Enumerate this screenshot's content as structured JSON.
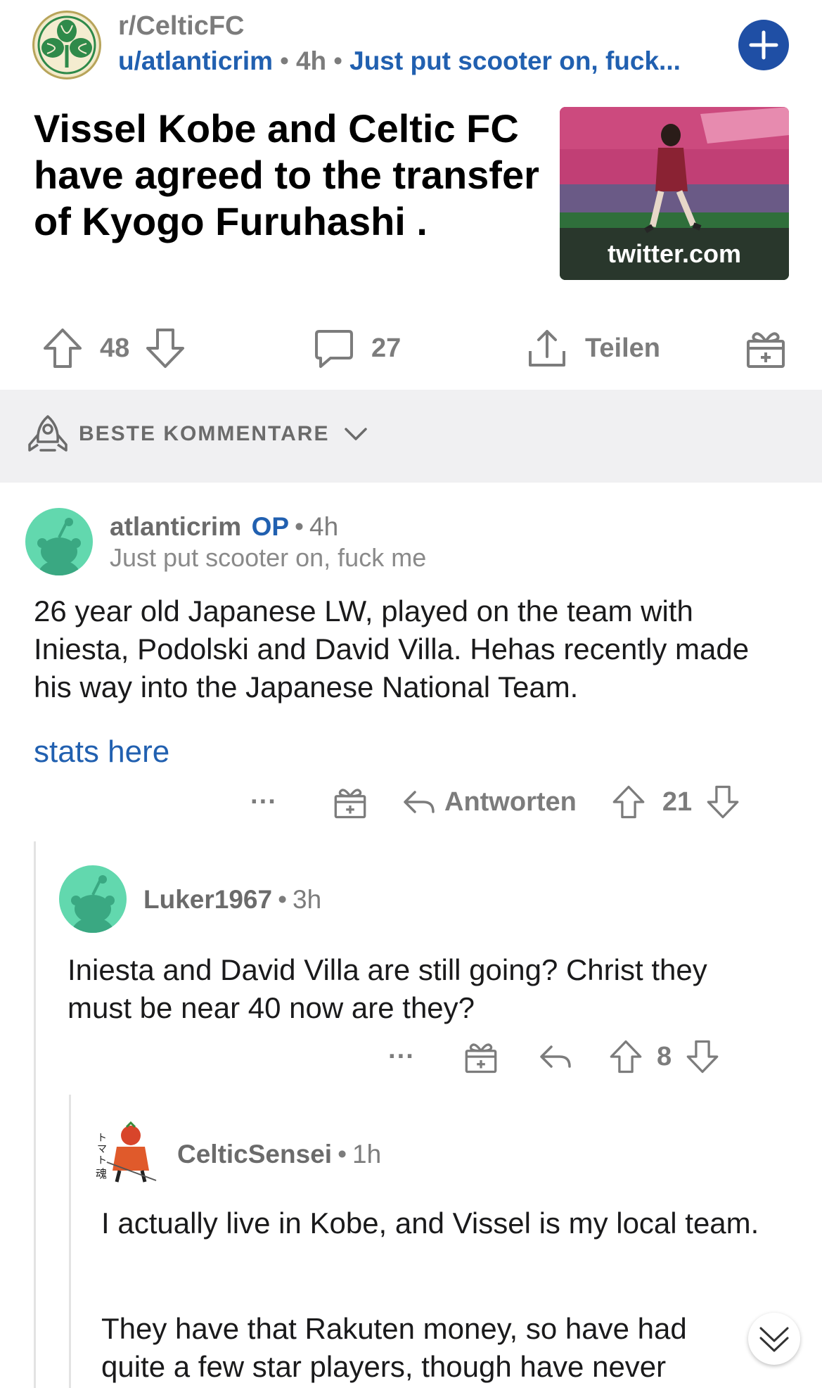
{
  "post": {
    "subreddit": "r/CelticFC",
    "author": "u/atlanticrim",
    "age": "4h",
    "flair": "Just put scooter on, fuck...",
    "title": "Vissel Kobe and Celtic FC have agreed to the transfer of Kyogo Furuhashi .",
    "thumbnail_domain": "twitter.com",
    "upvotes": "48",
    "comments": "27",
    "share_label": "Teilen"
  },
  "sort": {
    "label": "BESTE KOMMENTARE"
  },
  "comments": [
    {
      "author": "atlanticrim",
      "op_badge": "OP",
      "age": "4h",
      "flair": "Just put scooter on, fuck me",
      "body": "26 year old Japanese LW, played on the team with Iniesta, Podolski and David Villa. Hehas recently made his way into the Japanese National Team.",
      "link_text": "stats here",
      "more": "···",
      "reply_label": "Antworten",
      "score": "21"
    },
    {
      "author": "Luker1967",
      "age": "3h",
      "body": "Iniesta and David Villa are still going? Christ they must be near 40 now are they?",
      "more": "···",
      "score": "8"
    },
    {
      "author": "CelticSensei",
      "age": "1h",
      "body_p1": "I actually live in Kobe, and Vissel is my local team.",
      "body_p2": "They have that Rakuten money, so have had quite a few star players, though have never"
    }
  ],
  "colors": {
    "accent": "#2160b0",
    "join_button": "#1f4fa5",
    "avatar_green": "#62d8ae",
    "sortbar_bg": "#f0f0f2"
  },
  "icons": [
    "subreddit-clover-icon",
    "plus-icon",
    "upvote-icon",
    "downvote-icon",
    "comment-icon",
    "share-icon",
    "award-icon",
    "rocket-icon",
    "chevron-down-icon",
    "reply-icon",
    "snoo-avatar-icon",
    "scroll-down-icon"
  ]
}
